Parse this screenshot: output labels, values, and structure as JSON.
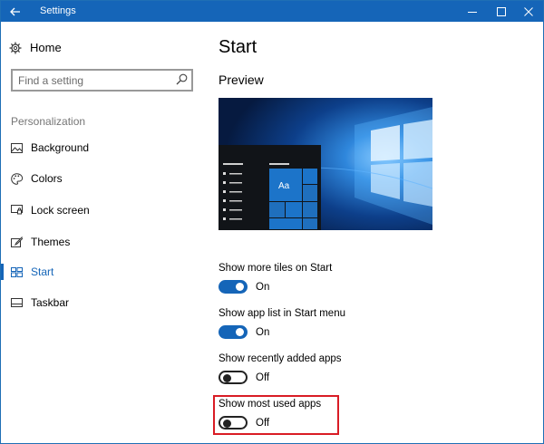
{
  "titlebar": {
    "title": "Settings",
    "back_icon": "back-arrow-icon",
    "minimize_icon": "minimize-icon",
    "maximize_icon": "maximize-icon",
    "close_icon": "close-icon"
  },
  "sidebar": {
    "home_label": "Home",
    "search": {
      "placeholder": "Find a setting",
      "value": ""
    },
    "section_label": "Personalization",
    "items": [
      {
        "label": "Background",
        "icon": "image-icon"
      },
      {
        "label": "Colors",
        "icon": "palette-icon"
      },
      {
        "label": "Lock screen",
        "icon": "lock-screen-icon"
      },
      {
        "label": "Themes",
        "icon": "brush-icon"
      },
      {
        "label": "Start",
        "icon": "start-tiles-icon",
        "selected": true
      },
      {
        "label": "Taskbar",
        "icon": "taskbar-icon"
      }
    ]
  },
  "main": {
    "title": "Start",
    "preview_heading": "Preview",
    "preview_tile_label": "Aa",
    "settings": [
      {
        "label": "Show more tiles on Start",
        "on": true,
        "state": "On"
      },
      {
        "label": "Show app list in Start menu",
        "on": true,
        "state": "On"
      },
      {
        "label": "Show recently added apps",
        "on": false,
        "state": "Off"
      },
      {
        "label": "Show most used apps",
        "on": false,
        "state": "Off"
      }
    ]
  },
  "colors": {
    "accent": "#1565b8",
    "highlight": "#d91c25"
  }
}
